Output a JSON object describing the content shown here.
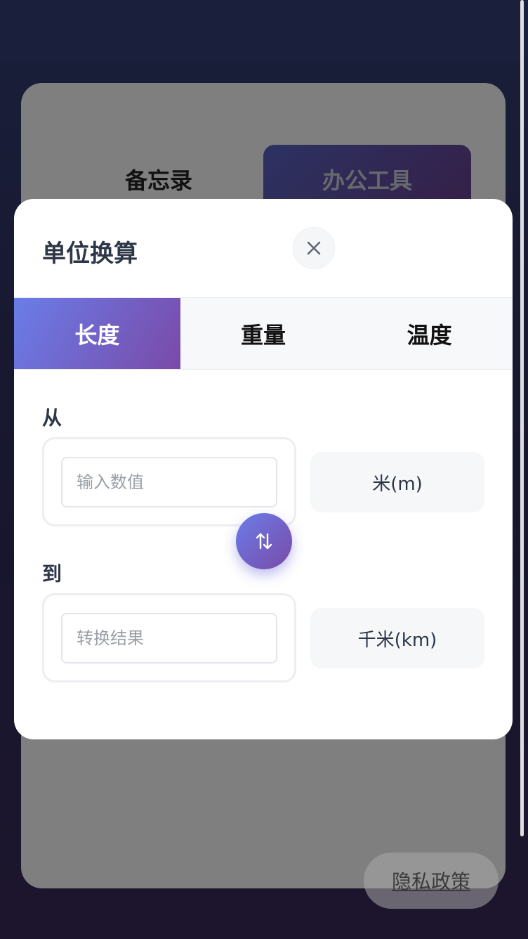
{
  "background": {
    "tabs": [
      "备忘录",
      "办公工具"
    ],
    "privacy_link": "隐私政策"
  },
  "modal": {
    "title": "单位换算",
    "close_icon": "close-icon",
    "tabs": [
      {
        "label": "长度",
        "active": true
      },
      {
        "label": "重量",
        "active": false
      },
      {
        "label": "温度",
        "active": false
      }
    ],
    "from": {
      "label": "从",
      "placeholder": "输入数值",
      "value": "",
      "unit": "米(m)"
    },
    "to": {
      "label": "到",
      "placeholder": "转换结果",
      "value": "",
      "unit": "千米(km)"
    },
    "swap_icon": "swap-vertical-icon"
  },
  "colors": {
    "accent_start": "#6a7de8",
    "accent_end": "#7a4aa8",
    "text_dark": "#2d3748"
  }
}
